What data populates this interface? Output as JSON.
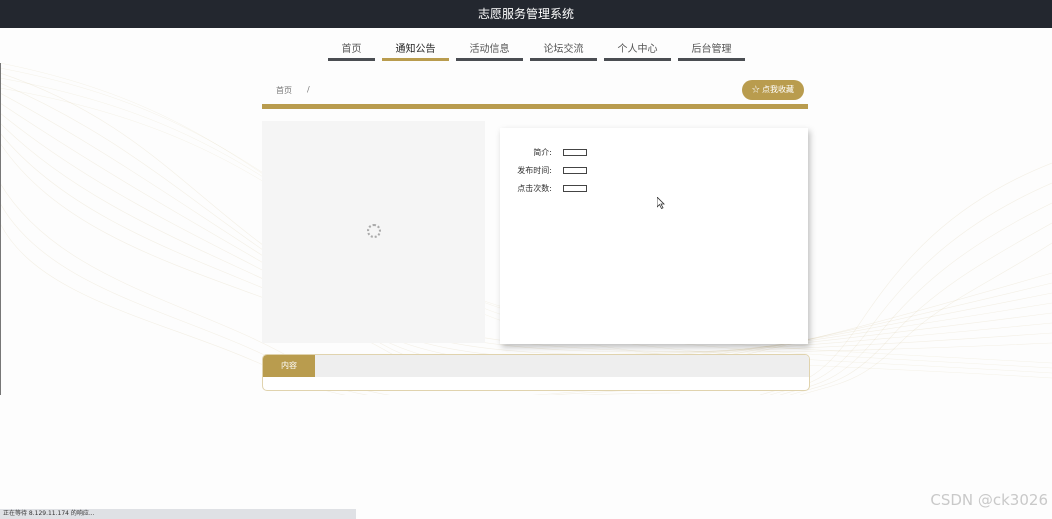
{
  "header": {
    "title": "志愿服务管理系统"
  },
  "nav": {
    "items": [
      {
        "label": "首页",
        "active": false
      },
      {
        "label": "通知公告",
        "active": true
      },
      {
        "label": "活动信息",
        "active": false
      },
      {
        "label": "论坛交流",
        "active": false
      },
      {
        "label": "个人中心",
        "active": false
      },
      {
        "label": "后台管理",
        "active": false
      }
    ]
  },
  "breadcrumb": {
    "home": "首页",
    "separator": "/"
  },
  "favorite_button": {
    "icon": "star-outline-icon",
    "label": "点我收藏"
  },
  "details": {
    "intro_label": "简介:",
    "publish_time_label": "发布时间:",
    "clicks_label": "点击次数:"
  },
  "content_tab": {
    "label": "内容"
  },
  "status_bar": {
    "text": "正在等待 8.129.11.174 的响应..."
  },
  "watermark": {
    "text": "CSDN @ck3026"
  },
  "colors": {
    "accent": "#b99c4e",
    "topbar": "#23272f",
    "nav_underline": "#4a4d52"
  }
}
